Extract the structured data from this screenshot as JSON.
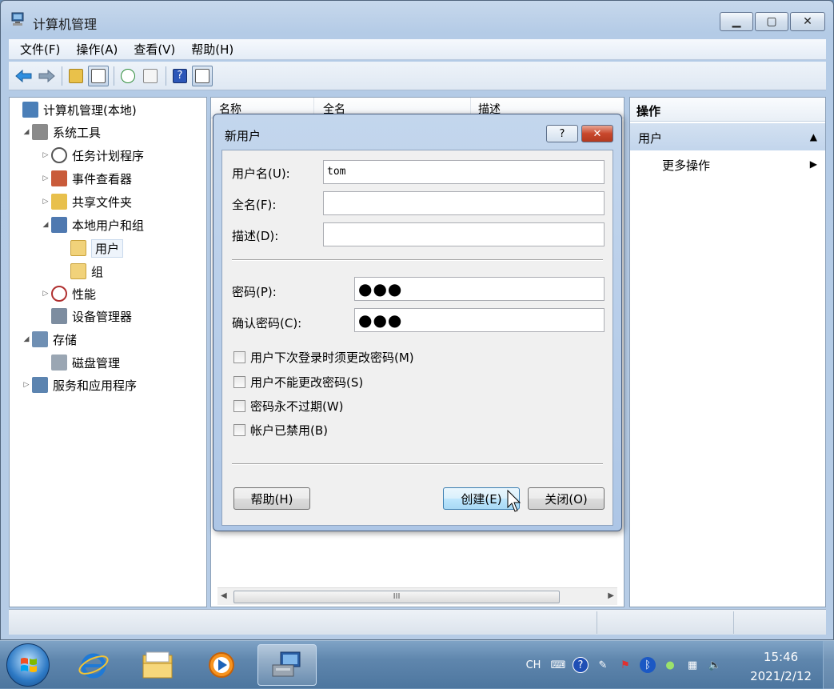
{
  "window": {
    "title": "计算机管理",
    "minimize_icon": "minimize-icon",
    "maximize_icon": "maximize-icon",
    "close_icon": "close-icon"
  },
  "menu": [
    "文件(F)",
    "操作(A)",
    "查看(V)",
    "帮助(H)"
  ],
  "toolbar": {
    "icons": [
      "back-arrow-icon",
      "forward-arrow-icon",
      "up-folder-icon",
      "show-hide-tree-icon",
      "refresh-icon",
      "export-list-icon",
      "help-icon",
      "show-hide-action-pane-icon"
    ]
  },
  "tree": {
    "items": [
      {
        "label": "计算机管理(本地)",
        "level": 0,
        "expander": "",
        "icon": "computer-management-icon"
      },
      {
        "label": "系统工具",
        "level": 1,
        "expander": "◢",
        "icon": "system-tools-icon"
      },
      {
        "label": "任务计划程序",
        "level": 2,
        "expander": "▷",
        "icon": "clock-icon"
      },
      {
        "label": "事件查看器",
        "level": 2,
        "expander": "▷",
        "icon": "event-viewer-icon"
      },
      {
        "label": "共享文件夹",
        "level": 2,
        "expander": "▷",
        "icon": "shared-folder-icon"
      },
      {
        "label": "本地用户和组",
        "level": 2,
        "expander": "◢",
        "icon": "users-groups-icon"
      },
      {
        "label": "用户",
        "level": 3,
        "expander": "",
        "icon": "folder-icon"
      },
      {
        "label": "组",
        "level": 3,
        "expander": "",
        "icon": "folder-icon"
      },
      {
        "label": "性能",
        "level": 2,
        "expander": "▷",
        "icon": "performance-icon"
      },
      {
        "label": "设备管理器",
        "level": 2,
        "expander": "",
        "icon": "device-manager-icon"
      },
      {
        "label": "存储",
        "level": 1,
        "expander": "◢",
        "icon": "storage-icon"
      },
      {
        "label": "磁盘管理",
        "level": 2,
        "expander": "",
        "icon": "disk-management-icon"
      },
      {
        "label": "服务和应用程序",
        "level": 1,
        "expander": "▷",
        "icon": "services-apps-icon"
      }
    ]
  },
  "list": {
    "columns": [
      "名称",
      "全名",
      "描述"
    ],
    "scroll_grip": "III"
  },
  "actions": {
    "header": "操作",
    "section": "用户",
    "item": "更多操作"
  },
  "dialog": {
    "title": "新用户",
    "help_btn": "?",
    "close_btn": "✕",
    "username_label": "用户名(U):",
    "username_value": "tom",
    "fullname_label": "全名(F):",
    "fullname_value": "",
    "desc_label": "描述(D):",
    "desc_value": "",
    "password_label": "密码(P):",
    "password_value": "●●●",
    "confirm_label": "确认密码(C):",
    "confirm_value": "●●●",
    "checkboxes": [
      {
        "label": "用户下次登录时须更改密码(M)",
        "checked": false
      },
      {
        "label": "用户不能更改密码(S)",
        "checked": false
      },
      {
        "label": "密码永不过期(W)",
        "checked": false
      },
      {
        "label": "帐户已禁用(B)",
        "checked": false
      }
    ],
    "help_button": "帮助(H)",
    "create_button": "创建(E)",
    "close_button": "关闭(O)"
  },
  "taskbar": {
    "apps": [
      "internet-explorer-icon",
      "windows-explorer-icon",
      "media-player-icon",
      "computer-management-icon"
    ],
    "tray": {
      "lang": "CH",
      "icons": [
        "keyboard-icon",
        "help-icon",
        "pen-icon",
        "action-center-flag-icon",
        "bluetooth-icon",
        "usb-safely-remove-icon",
        "network-icon",
        "volume-icon"
      ]
    },
    "time": "15:46",
    "date": "2021/2/12"
  }
}
